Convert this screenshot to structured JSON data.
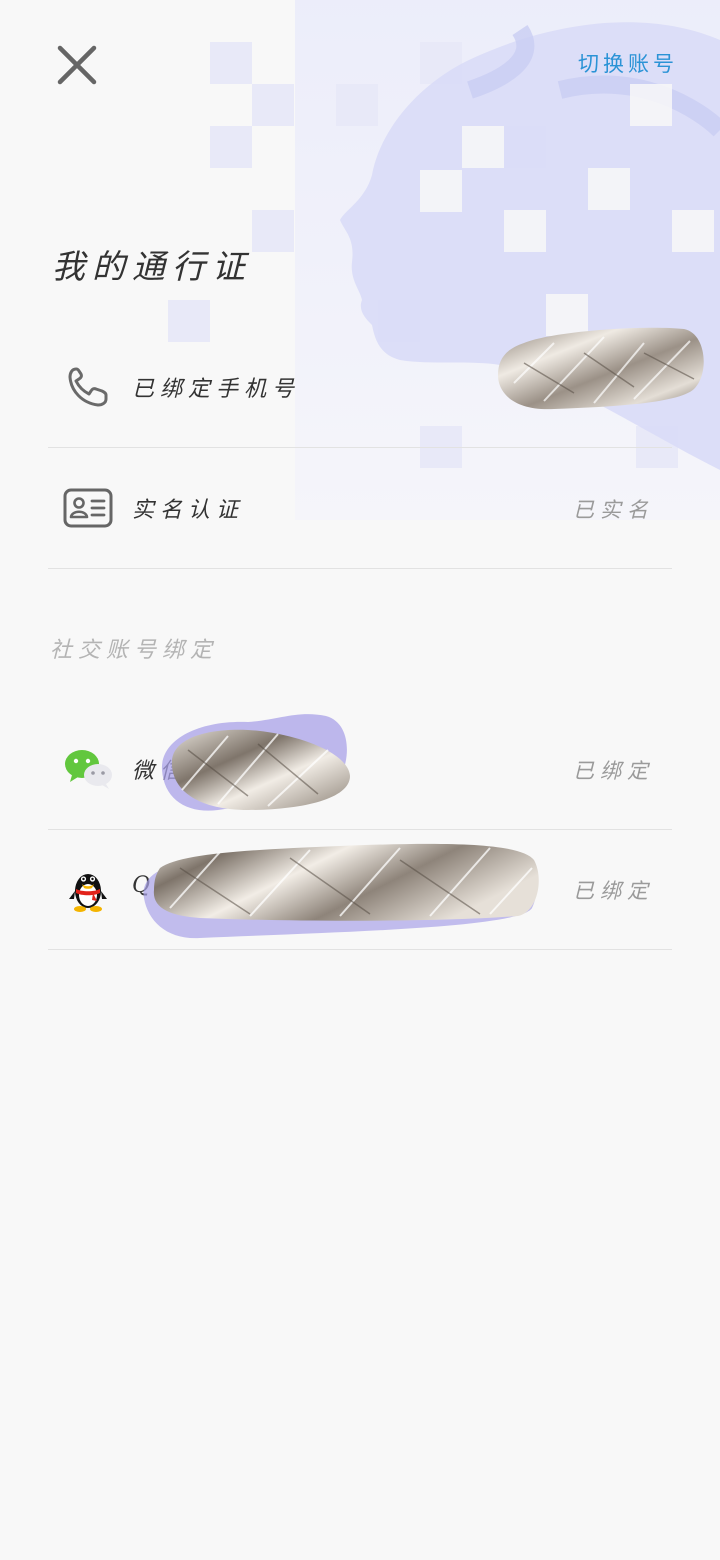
{
  "header": {
    "close_icon": "close-icon",
    "switch_account_label": "切换账号"
  },
  "page_title": "我的通行证",
  "account_rows": [
    {
      "icon": "phone-icon",
      "label": "已绑定手机号",
      "value": ""
    },
    {
      "icon": "id-card-icon",
      "label": "实名认证",
      "value": "已实名"
    }
  ],
  "social": {
    "section_title": "社交账号绑定",
    "items": [
      {
        "icon": "wechat-icon",
        "label": "微信",
        "status": "已绑定"
      },
      {
        "icon": "qq-icon",
        "label": "QQ",
        "status": "已绑定"
      }
    ]
  },
  "colors": {
    "accent": "#2b93d6",
    "background": "#f8f8f8",
    "divider": "#e2e2e2",
    "muted_text": "#9a9a9a",
    "section_title": "#b4b4b4",
    "art_tint": "#d9dcf7"
  }
}
